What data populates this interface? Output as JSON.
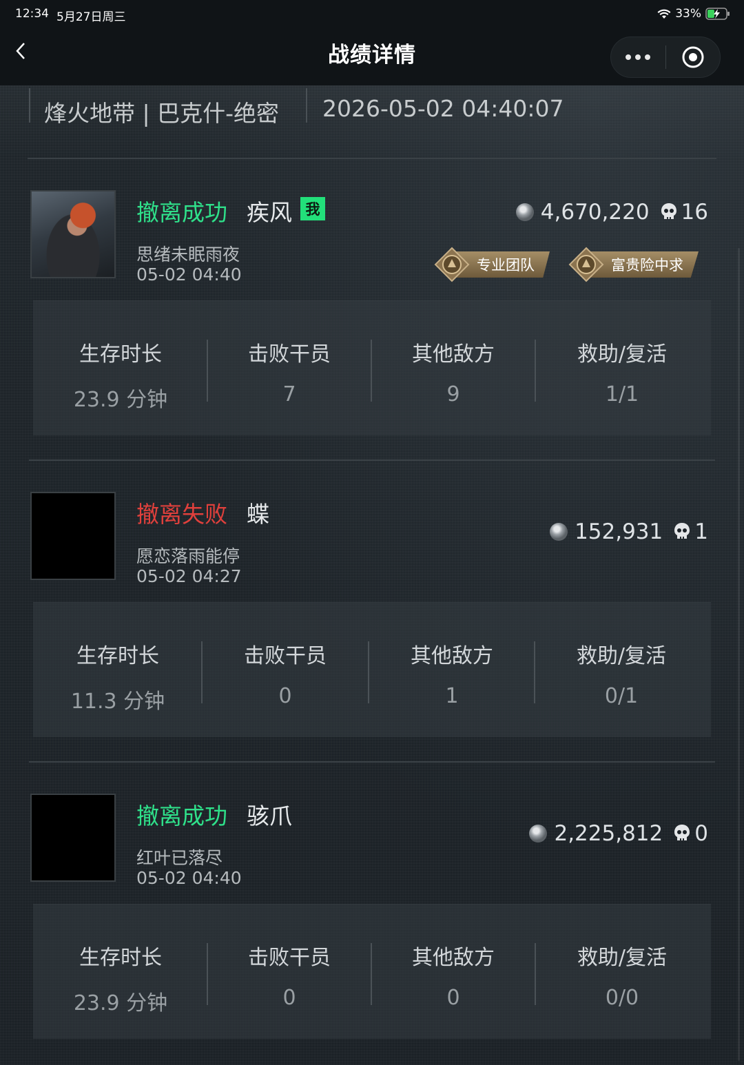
{
  "status_bar": {
    "time": "12:34",
    "date": "5月27日周三",
    "battery": "33%"
  },
  "nav": {
    "title": "战绩详情"
  },
  "header": {
    "map": "烽火地带 | 巴克什-绝密",
    "datetime": "2026-05-02 04:40:07"
  },
  "colors": {
    "success": "#2fe08a",
    "fail": "#e0403c",
    "me_badge": "#22e07a"
  },
  "players": [
    {
      "result": "撤离成功",
      "result_type": "success",
      "name": "疾风",
      "me_badge": "我",
      "account": "思绪未眠雨夜",
      "time": "05-02 04:40",
      "money": "4,670,220",
      "kills": "16",
      "medals": [
        "专业团队",
        "富贵险中求"
      ],
      "stats": [
        {
          "label": "生存时长",
          "value": "23.9 分钟"
        },
        {
          "label": "击败干员",
          "value": "7"
        },
        {
          "label": "其他敌方",
          "value": "9"
        },
        {
          "label": "救助/复活",
          "value": "1/1"
        }
      ]
    },
    {
      "result": "撤离失败",
      "result_type": "fail",
      "name": "蝶",
      "account": "愿恋落雨能停",
      "time": "05-02 04:27",
      "money": "152,931",
      "kills": "1",
      "stats": [
        {
          "label": "生存时长",
          "value": "11.3 分钟"
        },
        {
          "label": "击败干员",
          "value": "0"
        },
        {
          "label": "其他敌方",
          "value": "1"
        },
        {
          "label": "救助/复活",
          "value": "0/1"
        }
      ]
    },
    {
      "result": "撤离成功",
      "result_type": "success",
      "name": "骇爪",
      "account": "红叶已落尽",
      "time": "05-02 04:40",
      "money": "2,225,812",
      "kills": "0",
      "stats": [
        {
          "label": "生存时长",
          "value": "23.9 分钟"
        },
        {
          "label": "击败干员",
          "value": "0"
        },
        {
          "label": "其他敌方",
          "value": "0"
        },
        {
          "label": "救助/复活",
          "value": "0/0"
        }
      ]
    }
  ]
}
